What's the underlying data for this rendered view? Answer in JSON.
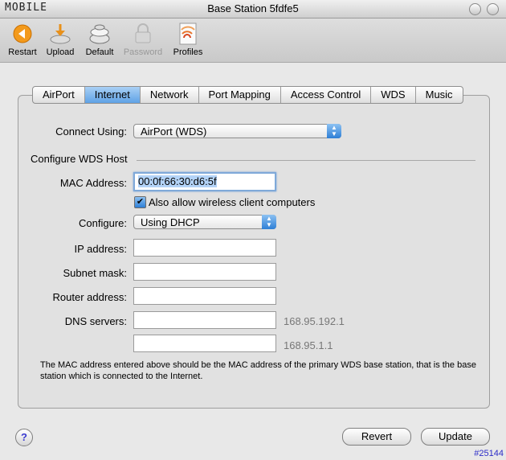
{
  "window": {
    "title": "Base Station 5fdfe5",
    "brand": "MOBILE"
  },
  "toolbar": {
    "items": [
      {
        "label": "Restart",
        "icon": "restart-icon",
        "enabled": true
      },
      {
        "label": "Upload",
        "icon": "upload-icon",
        "enabled": true
      },
      {
        "label": "Default",
        "icon": "default-icon",
        "enabled": true
      },
      {
        "label": "Password",
        "icon": "lock-icon",
        "enabled": false
      },
      {
        "label": "Profiles",
        "icon": "profiles-icon",
        "enabled": true
      }
    ]
  },
  "tabs": [
    "AirPort",
    "Internet",
    "Network",
    "Port Mapping",
    "Access Control",
    "WDS",
    "Music"
  ],
  "active_tab": "Internet",
  "form": {
    "connect_using_label": "Connect Using:",
    "connect_using_value": "AirPort (WDS)",
    "section_title": "Configure WDS Host",
    "mac_label": "MAC Address:",
    "mac_value": "00:0f:66:30:d6:5f",
    "allow_wireless_label": "Also allow wireless client computers",
    "allow_wireless_checked": true,
    "configure_label": "Configure:",
    "configure_value": "Using DHCP",
    "ip_label": "IP address:",
    "subnet_label": "Subnet mask:",
    "router_label": "Router address:",
    "dns_label": "DNS servers:",
    "dns1_hint": "168.95.192.1",
    "dns2_hint": "168.95.1.1",
    "note": "The MAC address entered above should be the MAC address of the primary WDS base station, that is the base station which is connected to the Internet."
  },
  "buttons": {
    "help": "?",
    "revert": "Revert",
    "update": "Update"
  },
  "corner_id": "#25144",
  "colors": {
    "accent": "#5fa2e6",
    "hint": "#777777"
  }
}
